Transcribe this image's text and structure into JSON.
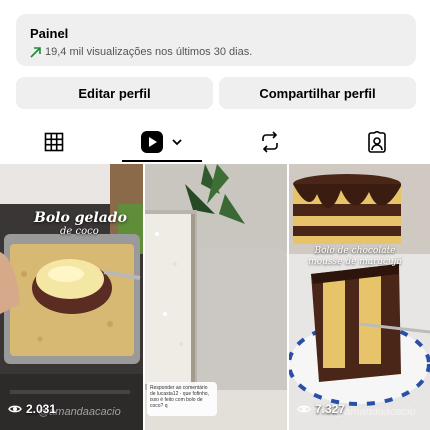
{
  "dashboard": {
    "title": "Painel",
    "stats": "19,4 mil visualizações nos últimos 30 dias.",
    "trend_color": "#1f8a3b"
  },
  "actions": {
    "edit_label": "Editar perfil",
    "share_label": "Compartilhar perfil"
  },
  "tabs": [
    {
      "icon": "grid-icon",
      "active": false
    },
    {
      "icon": "reels-icon",
      "active": true
    },
    {
      "icon": "reposts-icon",
      "active": false
    },
    {
      "icon": "tagged-icon",
      "active": false
    }
  ],
  "posts": [
    {
      "title": "Bolo gelado",
      "subtitle": "de coco",
      "views": "2.031",
      "watermark": "@amandaacacio"
    },
    {
      "comment": "Responder ao comentário de lucasta12 · que fofinho, isso é feito com bolo de coco? q",
      "views": ""
    },
    {
      "caption": "Bolo de chocolate mousse de maracujá",
      "views": "7.327",
      "watermark": "@amandaacacio"
    }
  ]
}
